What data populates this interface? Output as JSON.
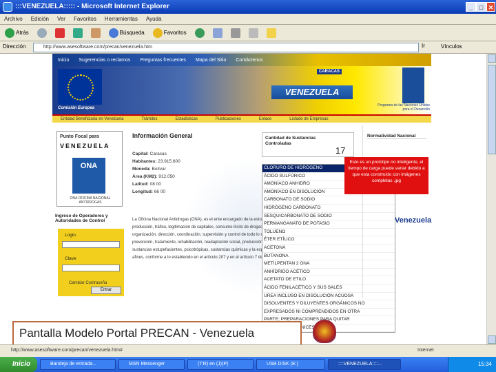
{
  "window": {
    "title": ":::VENEZUELA::::: - Microsoft Internet Explorer"
  },
  "menu": [
    "Archivo",
    "Edición",
    "Ver",
    "Favoritos",
    "Herramientas",
    "Ayuda"
  ],
  "toolbar": {
    "back": "Atrás",
    "search": "Búsqueda",
    "favorites": "Favoritos"
  },
  "address": {
    "label": "Dirección",
    "url": "http://www.asesoftware.com/precan/venezuela.htm",
    "go": "Ir",
    "links": "Vínculos"
  },
  "site": {
    "nav": [
      "Inicio",
      "Sugerencias o reclamos",
      "Preguntas frecuentes",
      "Mapa del Sitio",
      "Contáctenos"
    ],
    "eu_label": "Comisión Europea",
    "country_plate": "VENEZUELA",
    "city_tag": "CARACAS",
    "undp_caption": "Programa de las Naciones Unidas para el Desarrollo",
    "tabs": [
      "Entidad Beneficiaria en Venezuela",
      "Trámites",
      "Estadísticas",
      "Publicaciones",
      "Enlace",
      "Listado de Empresas"
    ],
    "focal": {
      "label": "Punto Focal para",
      "country": "VENEZUELA",
      "logo": "ONA",
      "logo_sub": "ONA OFICINA NACIONAL ANTIDROGAS"
    },
    "login": {
      "title": "Ingreso de Operadores y Autoridades de Control",
      "user_label": "Login",
      "pass_label": "Clave",
      "button": "Entrar",
      "change": "Cambiar Contraseña"
    },
    "info": {
      "title": "Información General",
      "fields": [
        {
          "k": "Capital:",
          "v": "Caracas"
        },
        {
          "k": "Habitantes:",
          "v": "23.915.600"
        },
        {
          "k": "Moneda:",
          "v": "Bolívar"
        },
        {
          "k": "Área (KM2):",
          "v": "912.050"
        },
        {
          "k": "Latitud:",
          "v": "08 00"
        },
        {
          "k": "Longitud:",
          "v": "66 00"
        }
      ],
      "body": "La Oficina Nacional Antidrogas (ONA), es el ente encargado de la estrategia del estado contra la producción, tráfico, legitimación de capitales, consumo ilícito de drogas, así como de la organización, dirección, coordinación, supervisión y control de todo lo relacionado con la prevención, tratamiento, rehabilitación, readaptación social, producción, tráfico y consumo ilícito de sustancias estupefacientes, psicotrópicas, sustancias químicas y la explotación de otros productos afines, conforme a lo establecido en el artículo 207 y en el artículo 7 de la ley en estudio."
    },
    "substances": {
      "label": "Cantidad de Sustancias Controladas",
      "count": "17",
      "items": [
        "CLORURO DE HIDRÓGENO",
        "ÁCIDO SULFÚRICO",
        "AMONÍACO ANHIDRO",
        "AMONÍACO EN DISOLUCIÓN",
        "CARBONATO DE SODIO",
        "HIDRÓGENO CARBONATO",
        "SESQUICARBONATO DE SODIO",
        "PERMANGANATO DE POTASIO",
        "TOLUENO",
        "ÉTER ETÍLICO",
        "ACETONA",
        "BUTANONA",
        "METILPENTAN 2 ONA",
        "ANHÍDRIDO ACÉTICO",
        "ACETATO DE ETILO",
        "ÁCIDO FENILACÉTICO Y SUS SALES",
        "UREA INCLUSO EN DISOLUCIÓN ACUOSA",
        "DISOLVENTES Y DILUYENTES ORGÁNICOS NO",
        "EXPRESADOS NI COMPRENDIDOS EN OTRA",
        "PARTE; PREPARACIONES PARA QUITAR",
        "PINTURAS Y BARNICES"
      ]
    },
    "warning": "Esto es un prototipo no inteligente, el tiempo de carga puede variar debido a que esta construido con imágenes completas .jpg",
    "right": {
      "normativity": "Normatividad Nacional",
      "brand": "Venezuela"
    }
  },
  "caption": "Pantalla Modelo Portal PRECAN - Venezuela",
  "status": {
    "text": "http://www.asesoftware.com/precan/venezuela.htm#",
    "zone": "Internet"
  },
  "taskbar": {
    "start": "Inicio",
    "tasks": [
      "Bandeja de entrada...",
      "MSN Messenger",
      "(T:R) en (J)(P)",
      "USB DISK (E:)",
      "::::VENEZUELA::::..."
    ],
    "clock": "15:34"
  }
}
